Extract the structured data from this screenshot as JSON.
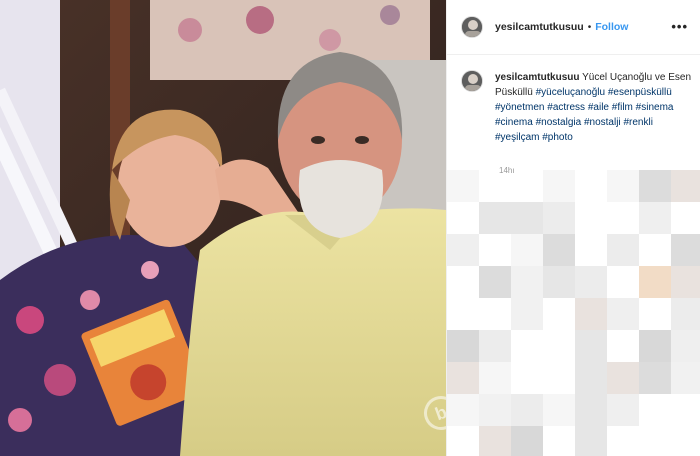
{
  "post": {
    "username": "yesilcamtutkusuu",
    "follow_label": "Follow",
    "separator": "•",
    "more_label": "•••",
    "caption_user": "yesilcamtutkusuu",
    "caption_text": "Yücel Uçanoğlu ve Esen Püsküllü",
    "hashtags": [
      "#yüceluçanoğlu",
      "#esenpüsküllü",
      "#yönetmen",
      "#actress",
      "#aile",
      "#film",
      "#sinema",
      "#cinema",
      "#nostalgia",
      "#nostalji",
      "#renkli",
      "#yeşilçam",
      "#photo"
    ],
    "likes_hint": "14hı"
  },
  "colors": {
    "link": "#3897f0",
    "hashtag": "#003569",
    "border": "#efefef"
  },
  "icons": {
    "more": "ellipsis-icon",
    "avatar": "profile-avatar"
  }
}
